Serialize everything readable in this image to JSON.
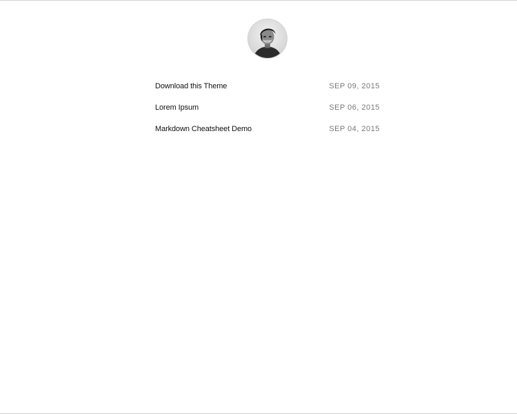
{
  "header": {
    "avatar_icon": "user-avatar-icon"
  },
  "posts": [
    {
      "title": "Download this Theme",
      "date": "SEP 09, 2015"
    },
    {
      "title": "Lorem Ipsum",
      "date": "SEP 06, 2015"
    },
    {
      "title": "Markdown Cheatsheet Demo",
      "date": "SEP 04, 2015"
    }
  ]
}
